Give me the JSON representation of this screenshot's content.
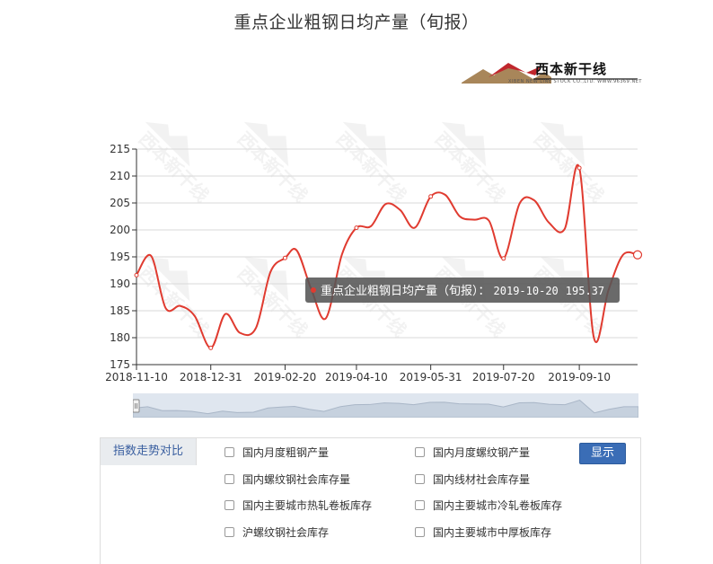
{
  "chart_data": {
    "type": "line",
    "title": "重点企业粗钢日均产量（旬报）",
    "ylim": [
      175,
      215
    ],
    "yticks": [
      175,
      180,
      185,
      190,
      195,
      200,
      205,
      210,
      215
    ],
    "xticks": [
      "2018-11-10",
      "2018-12-31",
      "2019-02-20",
      "2019-04-10",
      "2019-05-31",
      "2019-07-20",
      "2019-09-10"
    ],
    "series": [
      {
        "name": "重点企业粗钢日均产量（旬报）",
        "color": "#e03b30",
        "x": [
          "2018-11-10",
          "2018-11-20",
          "2018-11-30",
          "2018-12-10",
          "2018-12-20",
          "2018-12-31",
          "2019-01-10",
          "2019-01-20",
          "2019-01-31",
          "2019-02-10",
          "2019-02-20",
          "2019-02-28",
          "2019-03-10",
          "2019-03-20",
          "2019-03-31",
          "2019-04-10",
          "2019-04-20",
          "2019-04-30",
          "2019-05-10",
          "2019-05-20",
          "2019-05-31",
          "2019-06-10",
          "2019-06-20",
          "2019-06-30",
          "2019-07-10",
          "2019-07-20",
          "2019-07-31",
          "2019-08-10",
          "2019-08-20",
          "2019-08-31",
          "2019-09-10",
          "2019-09-20",
          "2019-09-30",
          "2019-10-10",
          "2019-10-20"
        ],
        "values": [
          191.6,
          195.2,
          185.5,
          185.9,
          184.0,
          178.1,
          184.4,
          180.9,
          181.8,
          192.2,
          194.8,
          196.2,
          189.0,
          183.6,
          195.4,
          200.4,
          200.7,
          204.8,
          203.7,
          200.4,
          206.2,
          206.5,
          202.5,
          201.9,
          201.7,
          194.7,
          204.9,
          205.5,
          201.4,
          200.2,
          211.5,
          180.0,
          188.8,
          195.37,
          195.37
        ]
      }
    ],
    "tooltip": {
      "series": "重点企业粗钢日均产量（旬报）",
      "separator": "：",
      "date": "2019-10-20",
      "value": "195.37"
    }
  },
  "brand": {
    "name": "西本新干线",
    "sub": "XIBEN NEW LINE STOCK CO.,LTD. WWW.96369.NET",
    "watermark": "西本新干线",
    "colors": {
      "red": "#c0272d",
      "gold": "#a8865a"
    }
  },
  "panel": {
    "title": "指数走势对比",
    "button": "显示",
    "options": [
      [
        "国内月度粗钢产量",
        "国内月度螺纹钢产量"
      ],
      [
        "国内螺纹钢社会库存量",
        "国内线材社会库存量"
      ],
      [
        "国内主要城市热轧卷板库存",
        "国内主要城市冷轧卷板库存"
      ],
      [
        "沪螺纹钢社会库存",
        "国内主要城市中厚板库存"
      ]
    ]
  }
}
